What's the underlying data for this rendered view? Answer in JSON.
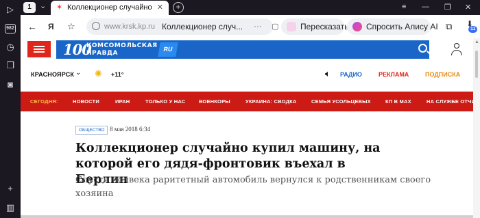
{
  "browser": {
    "tab_count": "1",
    "tab_title": "Коллекционер случайно",
    "address_host": "www.krsk.kp.ru",
    "address_title": "Коллекционер случ...",
    "retell_label": "Пересказать",
    "alice_label": "Спросить Алису AI",
    "rail_badge": "982",
    "notifications_badge": "11",
    "colors": {
      "chrome": "#1c1822",
      "accent": "#3a6df0"
    }
  },
  "site": {
    "logo_number": "100",
    "logo_line1": "КОМСОМОЛЬСКАЯ",
    "logo_line2": "ПРАВДА",
    "logo_ru": "RU",
    "colors": {
      "brand_blue": "#1a66c8",
      "brand_red": "#cc1a15",
      "today_yellow": "#f6c63d"
    }
  },
  "subbar": {
    "city": "КРАСНОЯРСК",
    "temperature": "+11°",
    "radio": "РАДИО",
    "advertising": "РЕКЛАМА",
    "subscription": "ПОДПИСКА"
  },
  "rubrics": {
    "today": "СЕГОДНЯ:",
    "items": [
      "НОВОСТИ",
      "ИРАН",
      "ТОЛЬКО У НАС",
      "ВОЕНКОРЫ",
      "УКРАИНА: СВОДКА",
      "СЕМЬЯ УСОЛЬЦЕВЫХ",
      "КП В MAX",
      "НА СЛУЖБЕ ОТЧИЗ"
    ]
  },
  "article": {
    "tag": "ОБЩЕСТВО",
    "date": "8 мая 2018 6:34",
    "headline": "Коллекционер случайно купил машину, на которой его дядя-фронтовик въехал в Берлин",
    "lead": "Спустя полвека раритетный автомобиль вернулся к родственникам своего хозяина"
  }
}
